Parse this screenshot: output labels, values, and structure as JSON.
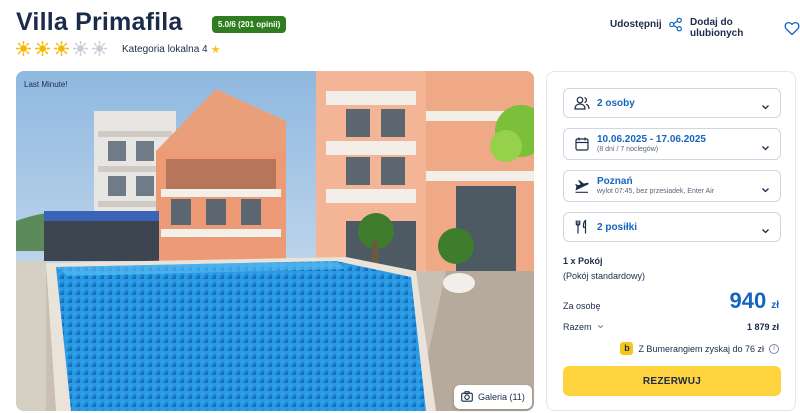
{
  "hotel": {
    "name": "Villa Primafila",
    "rating_badge": "5.0/6 (201 opinii)",
    "sun_rating": 3,
    "sun_total": 5,
    "category_label": "Kategoria lokalna 4"
  },
  "actions": {
    "share_label": "Udostępnij",
    "favorite_label": "Dodaj do ulubionych"
  },
  "photo": {
    "badge": "Last Minute!",
    "gallery_label": "Galeria (11)"
  },
  "booking": {
    "guests": "2 osoby",
    "dates": "10.06.2025 - 17.06.2025",
    "dates_sub": "(8 dni / 7 noclegów)",
    "departure": "Poznań",
    "departure_sub": "wylot 07:45, bez przesiadek, Enter Air",
    "meals": "2 posiłki",
    "room_title": "1 x Pokój",
    "room_sub": "(Pokój standardowy)",
    "per_person_label": "Za osobę",
    "price": "940",
    "currency": "zł",
    "total_label": "Razem",
    "total_value": "1 879 zł",
    "bumerang_text": "Z Bumerangiem zyskaj do 76 zł",
    "bumerang_logo": "b",
    "reserve_label": "REZERWUJ"
  },
  "colors": {
    "accent_blue": "#1565c0",
    "rating_green": "#2e7d1f",
    "cta_yellow": "#ffd33d",
    "sun": "#f5b700"
  }
}
